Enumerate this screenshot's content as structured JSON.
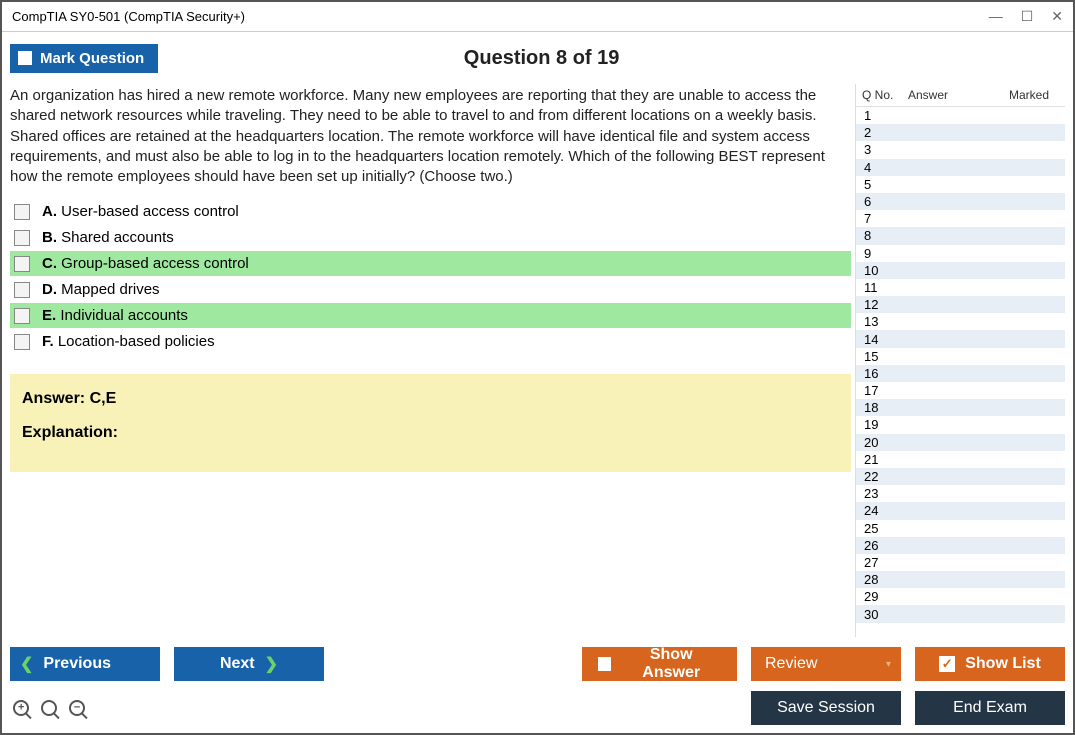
{
  "window": {
    "title": "CompTIA SY0-501 (CompTIA Security+)"
  },
  "header": {
    "mark_label": "Mark Question",
    "question_title": "Question 8 of 19"
  },
  "question": {
    "text": "An organization has hired a new remote workforce. Many new employees are reporting that they are unable to access the shared network resources while traveling. They need to be able to travel to and from different locations on a weekly basis. Shared offices are retained at the headquarters location. The remote workforce will have identical file and system access requirements, and must also be able to log in to the headquarters location remotely. Which of the following BEST represent how the remote employees should have been set up initially? (Choose two.)",
    "options": [
      {
        "letter": "A.",
        "text": "User-based access control",
        "correct": false
      },
      {
        "letter": "B.",
        "text": "Shared accounts",
        "correct": false
      },
      {
        "letter": "C.",
        "text": "Group-based access control",
        "correct": true
      },
      {
        "letter": "D.",
        "text": "Mapped drives",
        "correct": false
      },
      {
        "letter": "E.",
        "text": "Individual accounts",
        "correct": true
      },
      {
        "letter": "F.",
        "text": "Location-based policies",
        "correct": false
      }
    ]
  },
  "answer_box": {
    "answer_label": "Answer: C,E",
    "explanation_label": "Explanation:"
  },
  "sidepanel": {
    "headers": {
      "qno": "Q No.",
      "answer": "Answer",
      "marked": "Marked"
    },
    "rows": [
      1,
      2,
      3,
      4,
      5,
      6,
      7,
      8,
      9,
      10,
      11,
      12,
      13,
      14,
      15,
      16,
      17,
      18,
      19,
      20,
      21,
      22,
      23,
      24,
      25,
      26,
      27,
      28,
      29,
      30
    ]
  },
  "footer": {
    "previous": "Previous",
    "next": "Next",
    "show_answer": "Show Answer",
    "review": "Review",
    "show_list": "Show List",
    "save_session": "Save Session",
    "end_exam": "End Exam"
  }
}
